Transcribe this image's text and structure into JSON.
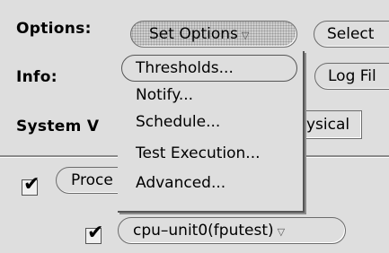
{
  "options": {
    "label": "Options:",
    "set_options_button": "Set Options",
    "select_button": "Select"
  },
  "info": {
    "label": "Info:",
    "log_files_button": "Log Fil"
  },
  "system_view": {
    "label": "System V",
    "physical_button": "ysical"
  },
  "menu": {
    "items": [
      {
        "label": "Thresholds..."
      },
      {
        "label": "Notify..."
      },
      {
        "label": "Schedule..."
      },
      {
        "label": "Test Execution..."
      },
      {
        "label": "Advanced..."
      }
    ]
  },
  "rows": {
    "processors_label": "Proce",
    "cpu_unit_label": "cpu–unit0(fputest)"
  },
  "icons": {
    "dropdown": "triangle-down",
    "checkmark": "check"
  }
}
